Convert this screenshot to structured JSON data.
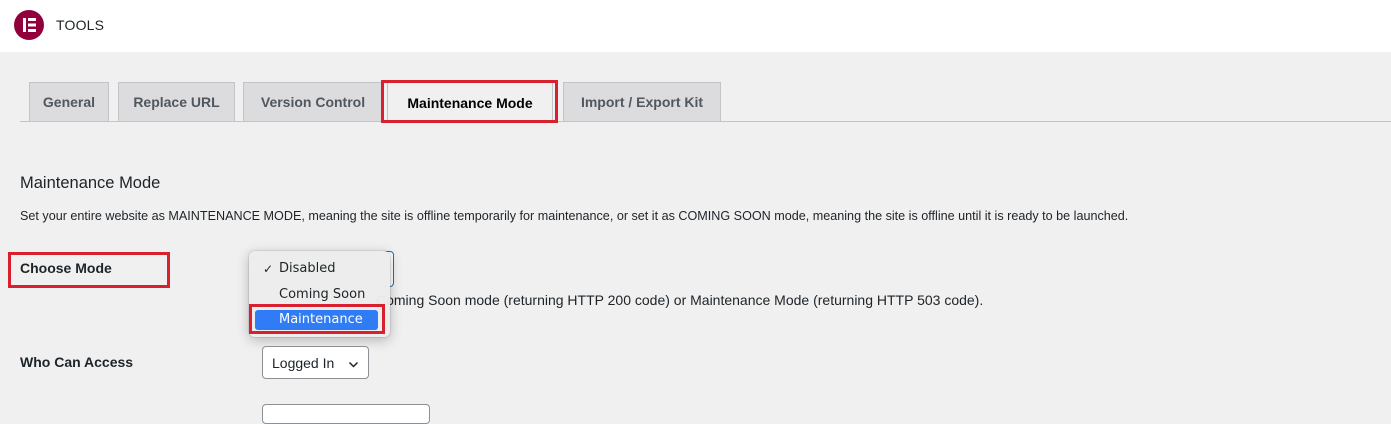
{
  "header": {
    "title": "TOOLS",
    "logo_icon": "elementor-logo-icon",
    "brand_color": "#92003b"
  },
  "tabs": [
    {
      "label": "General",
      "active": false
    },
    {
      "label": "Replace URL",
      "active": false
    },
    {
      "label": "Version Control",
      "active": false
    },
    {
      "label": "Maintenance Mode",
      "active": true
    },
    {
      "label": "Import / Export Kit",
      "active": false
    }
  ],
  "section": {
    "title": "Maintenance Mode",
    "description": "Set your entire website as MAINTENANCE MODE, meaning the site is offline temporarily for maintenance, or set it as COMING SOON mode, meaning the site is offline until it is ready to be launched."
  },
  "choose_mode": {
    "label": "Choose Mode",
    "options": [
      {
        "label": "Disabled",
        "checked": true
      },
      {
        "label": "Coming Soon",
        "checked": false
      },
      {
        "label": "Maintenance",
        "checked": false,
        "hovered": true
      }
    ],
    "help_text": "Coming Soon mode (returning HTTP 200 code) or Maintenance Mode (returning HTTP 503 code)."
  },
  "who_can_access": {
    "label": "Who Can Access",
    "value": "Logged In",
    "icon": "chevron-down-icon"
  },
  "colors": {
    "highlight": "#d9202e",
    "selection": "#2f7cf6"
  }
}
